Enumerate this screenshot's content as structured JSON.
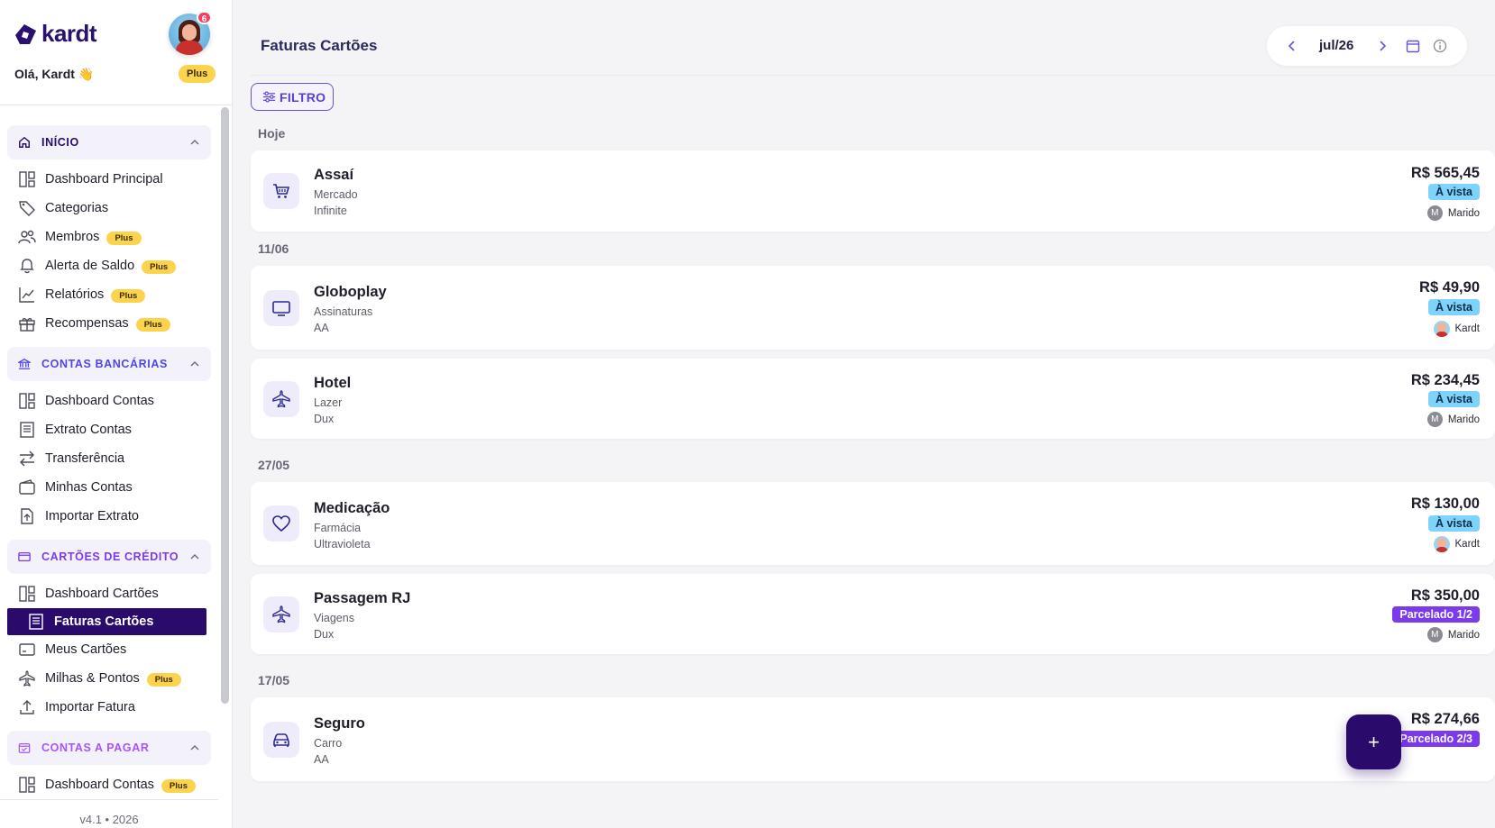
{
  "brand": {
    "name": "kardt"
  },
  "user": {
    "greeting": "Olá, Kardt 👋",
    "plan": "Plus",
    "notifications": "6"
  },
  "sidebar": {
    "sections": [
      {
        "title": "INÍCIO",
        "color": "#2a0a6b",
        "icon": "home-icon",
        "items": [
          {
            "label": "Dashboard Principal",
            "icon": "dashboard-icon",
            "plus": ""
          },
          {
            "label": "Categorias",
            "icon": "tag-icon",
            "plus": ""
          },
          {
            "label": "Membros",
            "icon": "users-icon",
            "plus": "Plus"
          },
          {
            "label": "Alerta de Saldo",
            "icon": "bell-icon",
            "plus": "Plus"
          },
          {
            "label": "Relatórios",
            "icon": "chart-icon",
            "plus": "Plus"
          },
          {
            "label": "Recompensas",
            "icon": "gift-icon",
            "plus": "Plus"
          }
        ]
      },
      {
        "title": "CONTAS BANCÁRIAS",
        "color": "#4f46e5",
        "icon": "bank-icon",
        "items": [
          {
            "label": "Dashboard Contas",
            "icon": "dashboard-icon",
            "plus": ""
          },
          {
            "label": "Extrato Contas",
            "icon": "receipt-icon",
            "plus": ""
          },
          {
            "label": "Transferência",
            "icon": "transfer-icon",
            "plus": ""
          },
          {
            "label": "Minhas Contas",
            "icon": "wallet-icon",
            "plus": ""
          },
          {
            "label": "Importar Extrato",
            "icon": "file-upload-icon",
            "plus": ""
          }
        ]
      },
      {
        "title": "CARTÕES DE CRÉDITO",
        "color": "#7c3aed",
        "icon": "credit-card-icon",
        "items": [
          {
            "label": "Dashboard Cartões",
            "icon": "dashboard-icon",
            "plus": ""
          },
          {
            "label": "Faturas Cartões",
            "icon": "receipt-icon",
            "plus": "",
            "active": true
          },
          {
            "label": "Meus Cartões",
            "icon": "card-icon",
            "plus": ""
          },
          {
            "label": "Milhas & Pontos",
            "icon": "plane-icon",
            "plus": "Plus"
          },
          {
            "label": "Importar Fatura",
            "icon": "upload-icon",
            "plus": ""
          }
        ]
      },
      {
        "title": "CONTAS A PAGAR",
        "color": "#a855f7",
        "icon": "calendar-check-icon",
        "items": [
          {
            "label": "Dashboard Contas",
            "icon": "dashboard-icon",
            "plus": "Plus"
          }
        ]
      }
    ],
    "footer": "v4.1 • 2026"
  },
  "header": {
    "title": "Faturas Cartões",
    "month": "jul/26"
  },
  "filter": {
    "label": "FILTRO"
  },
  "groups": [
    {
      "label": "Hoje"
    },
    {
      "label": "11/06"
    },
    {
      "label": "27/05"
    },
    {
      "label": "17/05"
    }
  ],
  "transactions": [
    {
      "name": "Assaí",
      "category": "Mercado",
      "card": "Infinite",
      "amount": "R$ 565,45",
      "type": "À vista",
      "owner": "Marido",
      "owner_initial": "M",
      "icon": "cart-icon"
    },
    {
      "name": "Globoplay",
      "category": "Assinaturas",
      "card": "AA",
      "amount": "R$ 49,90",
      "type": "À vista",
      "owner": "Kardt",
      "owner_initial": "",
      "icon": "monitor-icon"
    },
    {
      "name": "Hotel",
      "category": "Lazer",
      "card": "Dux",
      "amount": "R$ 234,45",
      "type": "À vista",
      "owner": "Marido",
      "owner_initial": "M",
      "icon": "plane-icon"
    },
    {
      "name": "Medicação",
      "category": "Farmácia",
      "card": "Ultravioleta",
      "amount": "R$ 130,00",
      "type": "À vista",
      "owner": "Kardt",
      "owner_initial": "",
      "icon": "heart-icon"
    },
    {
      "name": "Passagem RJ",
      "category": "Viagens",
      "card": "Dux",
      "amount": "R$ 350,00",
      "type": "Parcelado 1/2",
      "owner": "Marido",
      "owner_initial": "M",
      "icon": "plane-icon"
    },
    {
      "name": "Seguro",
      "category": "Carro",
      "card": "AA",
      "amount": "R$ 274,66",
      "type": "Parcelado 2/3",
      "owner": "",
      "owner_initial": "",
      "icon": "car-icon"
    }
  ],
  "fab": {
    "label": "+"
  }
}
